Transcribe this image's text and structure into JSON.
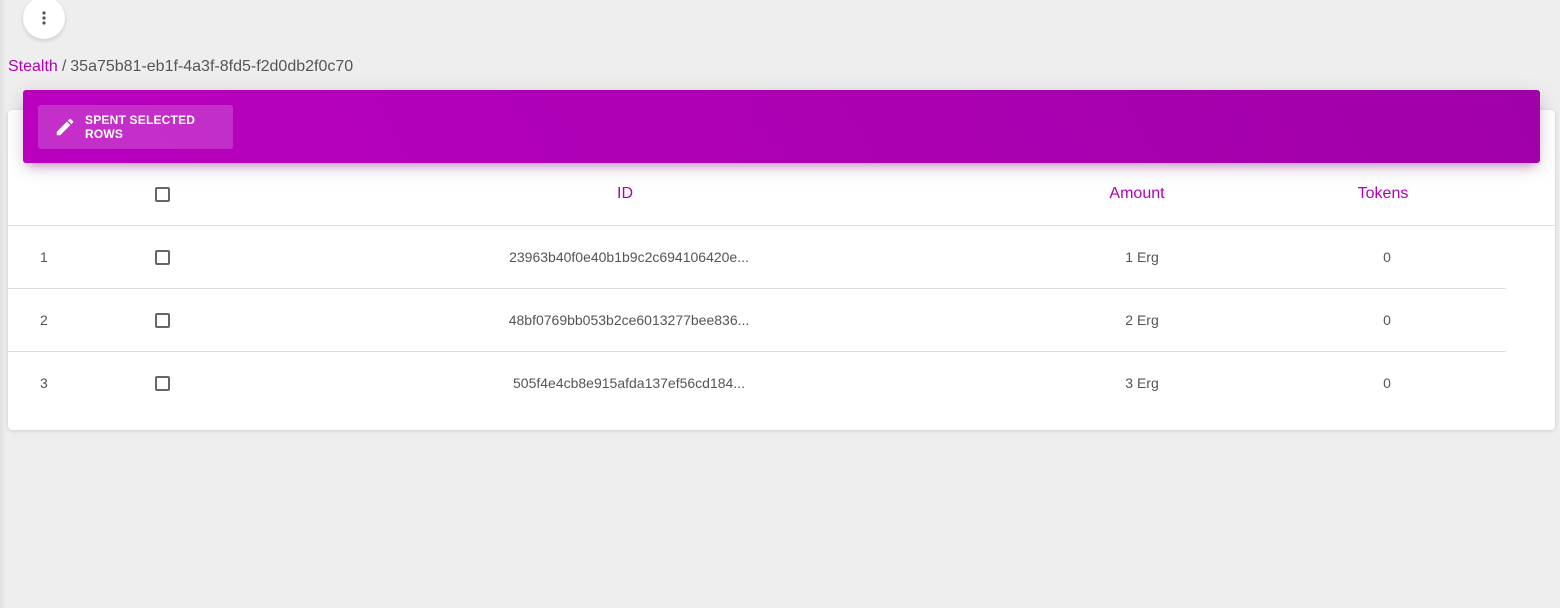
{
  "menu": {
    "icon": "more-vert-icon"
  },
  "breadcrumb": {
    "link": "Stealth",
    "separator": "/",
    "current": "35a75b81-eb1f-4a3f-8fd5-f2d0db2f0c70"
  },
  "toolbar": {
    "spent_label": "SPENT SELECTED ROWS",
    "spent_icon": "pencil-icon"
  },
  "table": {
    "columns": {
      "id": "ID",
      "amount": "Amount",
      "tokens": "Tokens"
    },
    "rows": [
      {
        "index": "1",
        "id": "23963b40f0e40b1b9c2c694106420e...",
        "amount": "1 Erg",
        "tokens": "0"
      },
      {
        "index": "2",
        "id": "48bf0769bb053b2ce6013277bee836...",
        "amount": "2 Erg",
        "tokens": "0"
      },
      {
        "index": "3",
        "id": "505f4e4cb8e915afda137ef56cd184...",
        "amount": "3 Erg",
        "tokens": "0"
      }
    ]
  },
  "colors": {
    "accent": "#b000b5",
    "header_gradient_start": "#b900bf",
    "header_gradient_end": "#a000a8",
    "background": "#eeeeee"
  }
}
